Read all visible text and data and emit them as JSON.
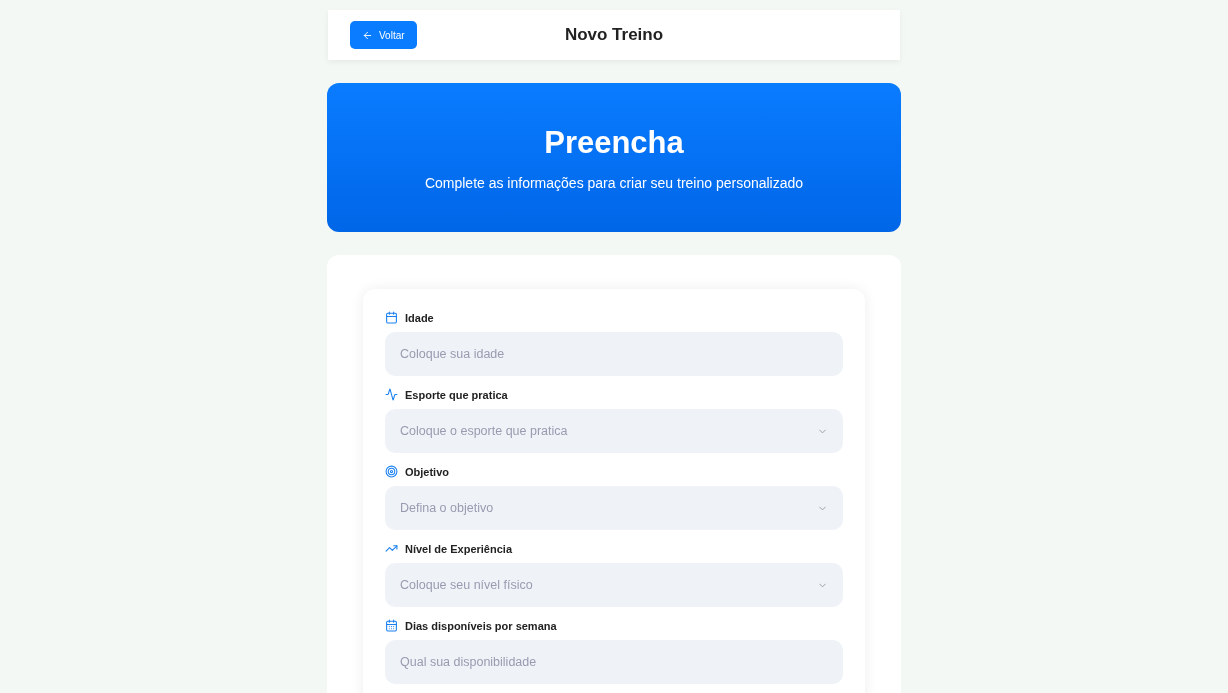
{
  "header": {
    "back_button": "Voltar",
    "title": "Novo Treino"
  },
  "hero": {
    "title": "Preencha",
    "subtitle": "Complete as informações para criar seu treino personalizado"
  },
  "form": {
    "fields": [
      {
        "kind": "input",
        "label": "Idade",
        "placeholder": "Coloque sua idade"
      },
      {
        "kind": "select",
        "label": "Esporte que pratica",
        "placeholder": "Coloque o esporte que pratica"
      },
      {
        "kind": "select",
        "label": "Objetivo",
        "placeholder": "Defina o objetivo"
      },
      {
        "kind": "select",
        "label": "Nível de Experiência",
        "placeholder": "Coloque seu nível físico"
      },
      {
        "kind": "input",
        "label": "Dias disponíveis por semana",
        "placeholder": "Qual sua disponibilidade"
      }
    ]
  }
}
